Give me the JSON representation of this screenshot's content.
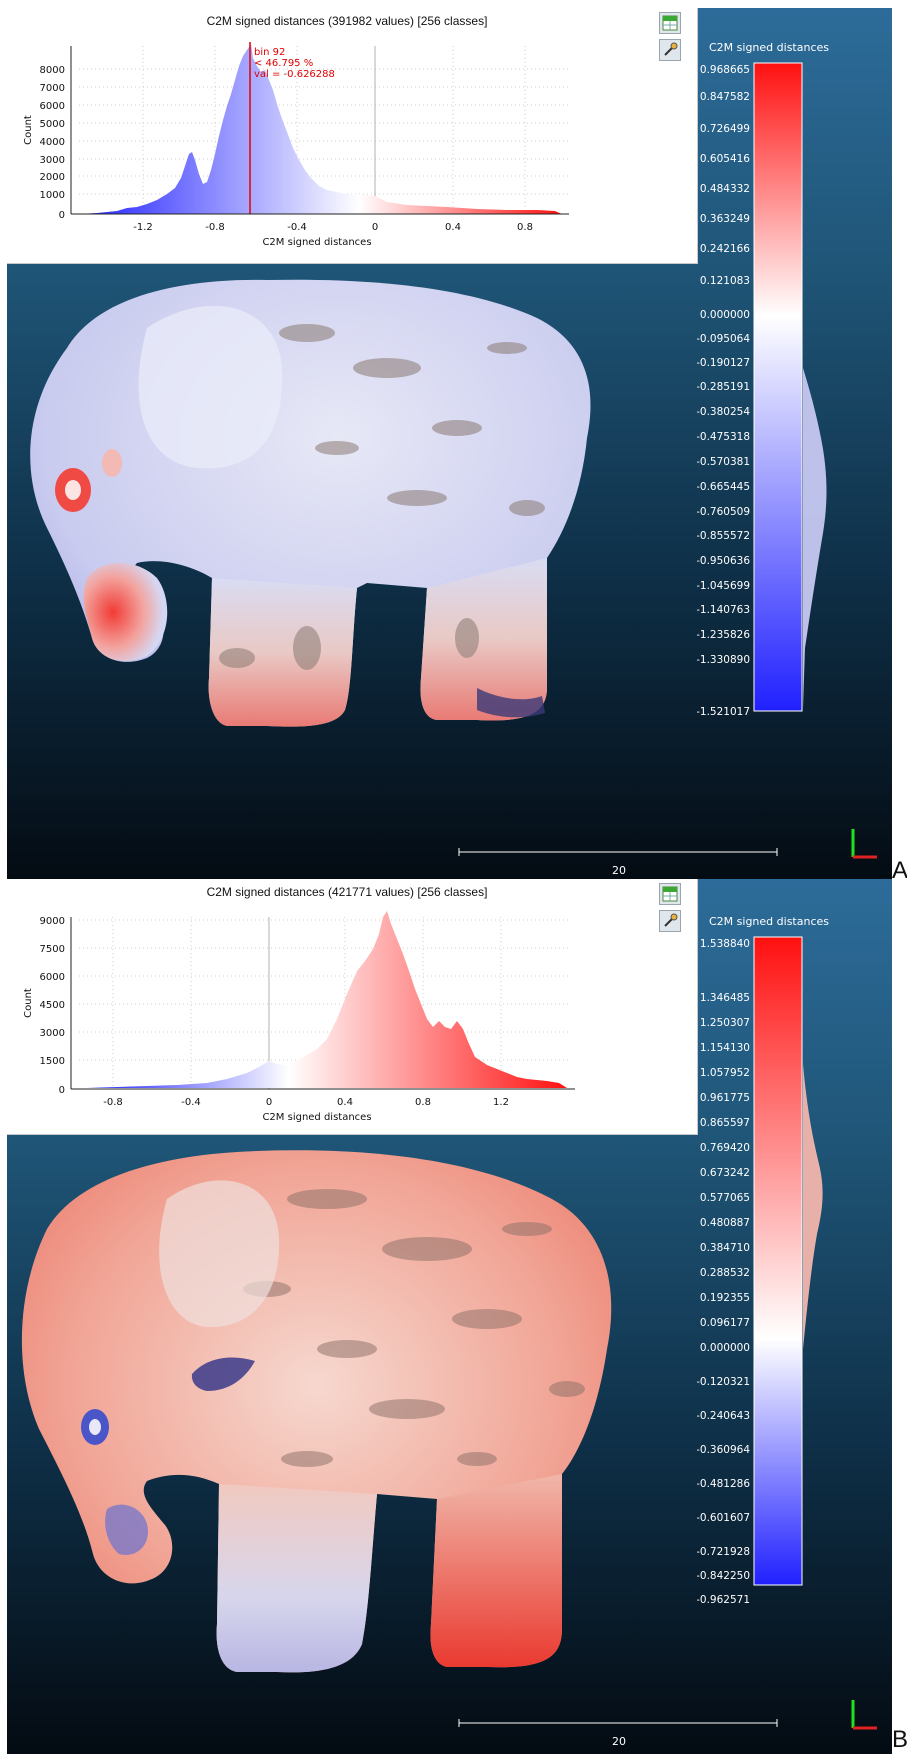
{
  "panels": [
    {
      "label": "A",
      "histogram": {
        "title": "C2M signed distances (391982 values)  [256 classes]",
        "x_axis_label": "C2M signed distances",
        "y_axis_label": "Count",
        "y_ticks": [
          0,
          1000,
          2000,
          3000,
          4000,
          5000,
          6000,
          7000,
          8000
        ],
        "x_ticks": [
          "-1.2",
          "-0.8",
          "-0.4",
          "0",
          "0.4",
          "0.8"
        ],
        "annotation": [
          "bin 92",
          "< 46.795 %",
          "val = -0.626288"
        ],
        "marker_color": "#e00000"
      },
      "color_scale": {
        "title": "C2M signed distances",
        "max_label": "0.968665",
        "min_label": "-1.521017",
        "tick_labels": [
          "0.847582",
          "0.726499",
          "0.605416",
          "0.484332",
          "0.363249",
          "0.242166",
          "0.121083",
          "0.000000",
          "-0.095064",
          "-0.190127",
          "-0.285191",
          "-0.380254",
          "-0.475318",
          "-0.570381",
          "-0.665445",
          "-0.760509",
          "-0.855572",
          "-0.950636",
          "-1.045699",
          "-1.140763",
          "-1.235826",
          "-1.330890"
        ]
      },
      "scale_bar_label": "20",
      "icons": [
        "csv-export-icon",
        "settings-icon"
      ]
    },
    {
      "label": "B",
      "histogram": {
        "title": "C2M signed distances (421771 values)  [256 classes]",
        "x_axis_label": "C2M signed distances",
        "y_axis_label": "Count",
        "y_ticks": [
          0,
          1500,
          3000,
          4500,
          6000,
          7500,
          9000
        ],
        "x_ticks": [
          "-0.8",
          "-0.4",
          "0",
          "0.4",
          "0.8",
          "1.2"
        ],
        "annotation": [],
        "marker_color": "#e00000"
      },
      "color_scale": {
        "title": "C2M signed distances",
        "max_label": "1.538840",
        "min_label": "-0.962571",
        "tick_labels": [
          "1.346485",
          "1.250307",
          "1.154130",
          "1.057952",
          "0.961775",
          "0.865597",
          "0.769420",
          "0.673242",
          "0.577065",
          "0.480887",
          "0.384710",
          "0.288532",
          "0.192355",
          "0.096177",
          "0.000000",
          "-0.120321",
          "-0.240643",
          "-0.360964",
          "-0.481286",
          "-0.601607",
          "-0.721928",
          "-0.842250"
        ]
      },
      "scale_bar_label": "20",
      "icons": [
        "csv-export-icon",
        "settings-icon"
      ]
    }
  ],
  "colors": {
    "blue": "#2020ff",
    "white": "#ffffff",
    "red": "#ff1010",
    "background_top": "#2d6c9a",
    "background_bottom": "#040b12"
  }
}
